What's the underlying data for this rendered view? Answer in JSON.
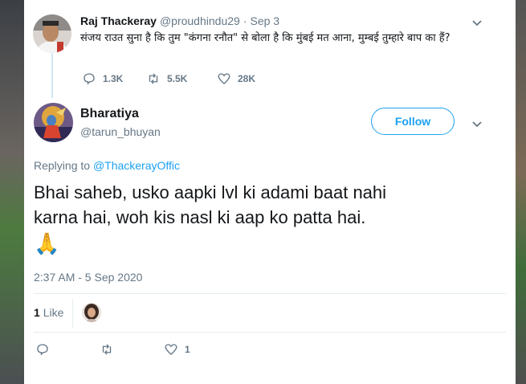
{
  "parent_tweet": {
    "display_name": "Raj Thackeray",
    "handle": "@proudhindu29",
    "separator": "·",
    "date": "Sep 3",
    "text": "संजय राउत सुना है कि तुम \"कंगना रनौत\" से बोला है कि मुंबई मत आना, मुम्बई तुम्हारे बाप का हैं?",
    "replies": "1.3K",
    "retweets": "5.5K",
    "likes": "28K"
  },
  "main_tweet": {
    "display_name": "Bharatiya",
    "handle": "@tarun_bhuyan",
    "follow_label": "Follow",
    "replying_prefix": "Replying to",
    "replying_to": "@ThackerayOffic",
    "text_line1": "Bhai saheb, usko aapki lvl ki adami baat nahi",
    "text_line2": "karna hai, woh kis nasl ki aap ko patta hai.",
    "emoji": "🙏",
    "timestamp": "2:37 AM - 5 Sep 2020",
    "like_count": "1",
    "like_label": "Like",
    "action_like_count": "1"
  },
  "colors": {
    "accent": "#1da1f2",
    "muted": "#657786",
    "divider": "#e6ecf0",
    "thread_line": "#cfe6f6"
  },
  "icons": [
    "chevron-down-icon",
    "reply-icon",
    "retweet-icon",
    "heart-icon"
  ]
}
